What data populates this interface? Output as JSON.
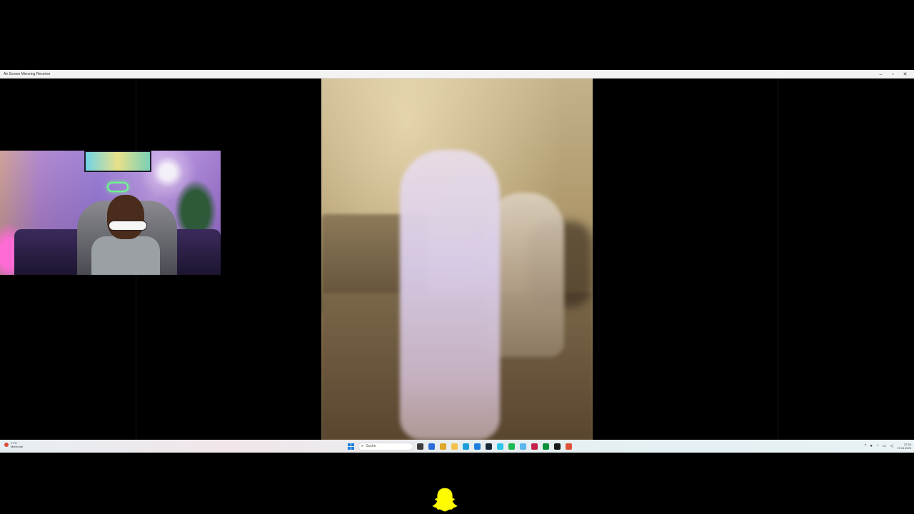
{
  "window": {
    "title": "Air Screen Mirroring Receiver",
    "controls": {
      "minimize": "–",
      "maximize": "▫",
      "close": "✕"
    }
  },
  "webcam": {
    "label": ""
  },
  "video": {
    "label": ""
  },
  "taskbar": {
    "weather": {
      "temp": "17°C",
      "desc": "Meist klar"
    },
    "search_placeholder": "Suche",
    "apps": [
      {
        "name": "file-explorer-icon",
        "color": "#3d3d3d"
      },
      {
        "name": "store-icon",
        "color": "#2b6cd6"
      },
      {
        "name": "chrome-icon",
        "color": "#e0a82a"
      },
      {
        "name": "folder-icon",
        "color": "#f2c14e"
      },
      {
        "name": "edge-icon",
        "color": "#1b9fd8"
      },
      {
        "name": "app-blue-icon",
        "color": "#1e7fe0"
      },
      {
        "name": "steam-icon",
        "color": "#1b2838"
      },
      {
        "name": "app-cyan-icon",
        "color": "#2ec5e8"
      },
      {
        "name": "spotify-icon",
        "color": "#1db954"
      },
      {
        "name": "app-lightblue-icon",
        "color": "#5eb6ee"
      },
      {
        "name": "tiktok-icon",
        "color": "#c4214d"
      },
      {
        "name": "app-green-icon",
        "color": "#0a8f3a"
      },
      {
        "name": "terminal-icon",
        "color": "#1a1a1a"
      },
      {
        "name": "app-red-icon",
        "color": "#e0533b"
      }
    ],
    "clock": {
      "time": "22:34",
      "date": "17.04.2025"
    }
  },
  "colors": {
    "background": "#000000",
    "titlebar": "#f3f3f3",
    "snap_yellow": "#fffc00"
  }
}
